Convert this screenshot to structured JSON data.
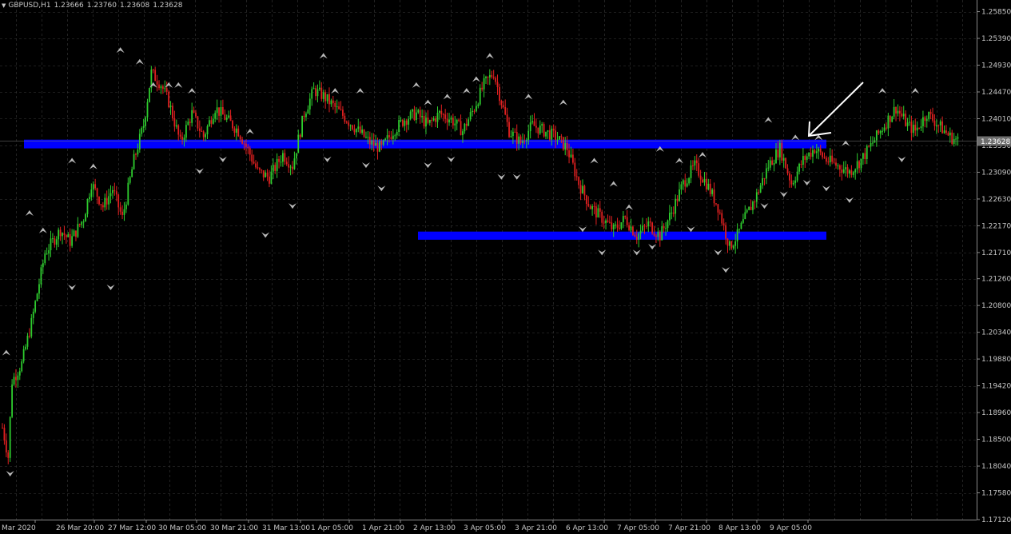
{
  "header": {
    "symbol": "GBPUSD,H1",
    "open": "1.23666",
    "high": "1.23760",
    "low": "1.23608",
    "close": "1.23628"
  },
  "chart_data": {
    "type": "candlestick",
    "symbol": "GBPUSD",
    "timeframe": "H1",
    "ylim": [
      1.1712,
      1.2605
    ],
    "y_ticks": [
      "1.25850",
      "1.25390",
      "1.24930",
      "1.24470",
      "1.24010",
      "1.23550",
      "1.23090",
      "1.22630",
      "1.22170",
      "1.21710",
      "1.21260",
      "1.20800",
      "1.20340",
      "1.19880",
      "1.19420",
      "1.18960",
      "1.18500",
      "1.18040",
      "1.17580",
      "1.17120"
    ],
    "x_ticks": [
      "Mar 2020",
      "26 Mar 20:00",
      "27 Mar 12:00",
      "30 Mar 05:00",
      "30 Mar 21:00",
      "31 Mar 13:00",
      "1 Apr 05:00",
      "1 Apr 21:00",
      "2 Apr 13:00",
      "3 Apr 05:00",
      "3 Apr 21:00",
      "6 Apr 13:00",
      "7 Apr 05:00",
      "7 Apr 21:00",
      "8 Apr 13:00",
      "9 Apr 05:00"
    ],
    "current_price": "1.23628",
    "bull_color": "#2ecc2e",
    "bear_color": "#e02020",
    "zones": [
      {
        "from": 1.235,
        "to": 1.2365,
        "color": "#0000ff",
        "start_tick": "Mar 2020",
        "end_tick": "9 Apr 05:00"
      },
      {
        "from": 1.2193,
        "to": 1.2207,
        "color": "#0000ff",
        "start_tick": "2 Apr 13:00",
        "end_tick": "9 Apr 05:00"
      }
    ],
    "close_path": [
      [
        0,
        1.187
      ],
      [
        3,
        1.182
      ],
      [
        5,
        1.195
      ],
      [
        10,
        1.198
      ],
      [
        15,
        1.205
      ],
      [
        22,
        1.217
      ],
      [
        30,
        1.221
      ],
      [
        35,
        1.219
      ],
      [
        42,
        1.223
      ],
      [
        46,
        1.229
      ],
      [
        52,
        1.225
      ],
      [
        57,
        1.228
      ],
      [
        62,
        1.223
      ],
      [
        68,
        1.233
      ],
      [
        73,
        1.239
      ],
      [
        77,
        1.248
      ],
      [
        82,
        1.246
      ],
      [
        86,
        1.243
      ],
      [
        92,
        1.236
      ],
      [
        98,
        1.241
      ],
      [
        104,
        1.237
      ],
      [
        110,
        1.242
      ],
      [
        116,
        1.24
      ],
      [
        122,
        1.238
      ],
      [
        128,
        1.234
      ],
      [
        132,
        1.231
      ],
      [
        138,
        1.23
      ],
      [
        145,
        1.234
      ],
      [
        150,
        1.232
      ],
      [
        156,
        1.241
      ],
      [
        161,
        1.245
      ],
      [
        166,
        1.244
      ],
      [
        172,
        1.242
      ],
      [
        178,
        1.24
      ],
      [
        184,
        1.238
      ],
      [
        190,
        1.236
      ],
      [
        196,
        1.235
      ],
      [
        202,
        1.238
      ],
      [
        208,
        1.24
      ],
      [
        214,
        1.241
      ],
      [
        220,
        1.239
      ],
      [
        226,
        1.241
      ],
      [
        232,
        1.24
      ],
      [
        238,
        1.238
      ],
      [
        244,
        1.242
      ],
      [
        249,
        1.246
      ],
      [
        254,
        1.248
      ],
      [
        258,
        1.243
      ],
      [
        262,
        1.238
      ],
      [
        268,
        1.236
      ],
      [
        274,
        1.239
      ],
      [
        280,
        1.238
      ],
      [
        286,
        1.237
      ],
      [
        292,
        1.235
      ],
      [
        298,
        1.229
      ],
      [
        304,
        1.225
      ],
      [
        310,
        1.223
      ],
      [
        316,
        1.221
      ],
      [
        322,
        1.223
      ],
      [
        328,
        1.22
      ],
      [
        334,
        1.222
      ],
      [
        340,
        1.22
      ],
      [
        346,
        1.224
      ],
      [
        352,
        1.229
      ],
      [
        358,
        1.232
      ],
      [
        364,
        1.229
      ],
      [
        370,
        1.225
      ],
      [
        376,
        1.218
      ],
      [
        380,
        1.22
      ],
      [
        384,
        1.223
      ],
      [
        390,
        1.227
      ],
      [
        396,
        1.232
      ],
      [
        402,
        1.235
      ],
      [
        408,
        1.229
      ],
      [
        414,
        1.233
      ],
      [
        420,
        1.235
      ],
      [
        426,
        1.233
      ],
      [
        432,
        1.232
      ],
      [
        438,
        1.231
      ],
      [
        444,
        1.233
      ],
      [
        450,
        1.236
      ],
      [
        456,
        1.239
      ],
      [
        462,
        1.242
      ],
      [
        468,
        1.239
      ],
      [
        472,
        1.238
      ],
      [
        478,
        1.241
      ],
      [
        484,
        1.239
      ],
      [
        490,
        1.237
      ],
      [
        494,
        1.23628
      ]
    ],
    "fractals_up": [
      [
        2,
        1.199
      ],
      [
        14,
        1.223
      ],
      [
        21,
        1.22
      ],
      [
        36,
        1.232
      ],
      [
        47,
        1.231
      ],
      [
        61,
        1.251
      ],
      [
        71,
        1.249
      ],
      [
        78,
        1.245
      ],
      [
        86,
        1.245
      ],
      [
        91,
        1.245
      ],
      [
        98,
        1.244
      ],
      [
        128,
        1.237
      ],
      [
        166,
        1.25
      ],
      [
        172,
        1.244
      ],
      [
        185,
        1.244
      ],
      [
        214,
        1.245
      ],
      [
        220,
        1.242
      ],
      [
        230,
        1.243
      ],
      [
        240,
        1.244
      ],
      [
        245,
        1.246
      ],
      [
        252,
        1.25
      ],
      [
        272,
        1.243
      ],
      [
        290,
        1.242
      ],
      [
        306,
        1.232
      ],
      [
        316,
        1.228
      ],
      [
        324,
        1.224
      ],
      [
        340,
        1.234
      ],
      [
        350,
        1.232
      ],
      [
        362,
        1.233
      ],
      [
        396,
        1.239
      ],
      [
        410,
        1.236
      ],
      [
        422,
        1.236
      ],
      [
        436,
        1.235
      ],
      [
        455,
        1.244
      ],
      [
        472,
        1.244
      ]
    ],
    "fractals_down": [
      [
        4,
        1.18
      ],
      [
        36,
        1.212
      ],
      [
        56,
        1.212
      ],
      [
        102,
        1.232
      ],
      [
        114,
        1.234
      ],
      [
        136,
        1.221
      ],
      [
        150,
        1.226
      ],
      [
        168,
        1.234
      ],
      [
        188,
        1.233
      ],
      [
        196,
        1.229
      ],
      [
        220,
        1.233
      ],
      [
        232,
        1.234
      ],
      [
        258,
        1.231
      ],
      [
        266,
        1.231
      ],
      [
        300,
        1.222
      ],
      [
        310,
        1.218
      ],
      [
        328,
        1.218
      ],
      [
        336,
        1.219
      ],
      [
        356,
        1.222
      ],
      [
        370,
        1.218
      ],
      [
        374,
        1.215
      ],
      [
        394,
        1.226
      ],
      [
        404,
        1.228
      ],
      [
        416,
        1.23
      ],
      [
        426,
        1.229
      ],
      [
        438,
        1.227
      ],
      [
        465,
        1.234
      ]
    ],
    "annotation": {
      "type": "arrow",
      "color": "#ffffff"
    }
  }
}
